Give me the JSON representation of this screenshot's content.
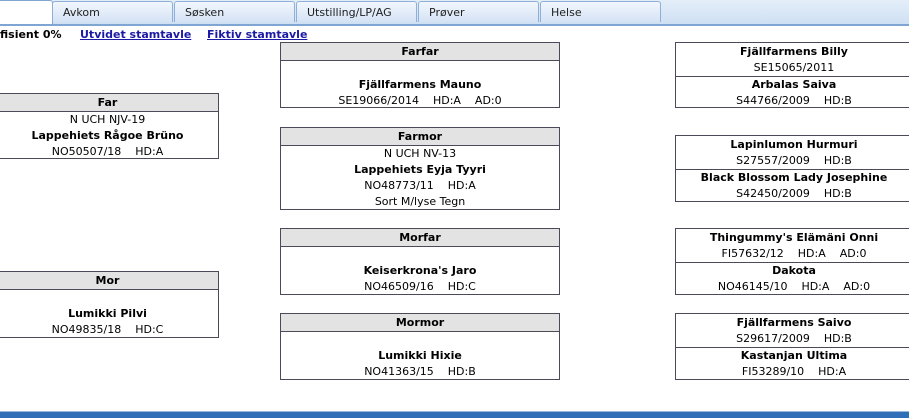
{
  "tabs": [
    "",
    "Avkom",
    "Søsken",
    "Utstilling/LP/AG",
    "Prøver",
    "Helse"
  ],
  "top": {
    "coefficient": "fisient 0%",
    "extended_link": "Utvidet stamtavle",
    "fictive_link": "Fiktiv stamtavle"
  },
  "parents": {
    "far": {
      "header": "Far",
      "title": "N UCH NJV-19",
      "name": "Lappehiets Rågoe Brüno",
      "reg": "NO50507/18    HD:A"
    },
    "mor": {
      "header": "Mor",
      "title": "",
      "name": "Lumikki Pilvi",
      "reg": "NO49835/18    HD:C"
    }
  },
  "grandparents": {
    "farfar": {
      "header": "Farfar",
      "title": "",
      "name": "Fjällfarmens Mauno",
      "reg": "SE19066/2014    HD:A    AD:0",
      "extra": ""
    },
    "farmor": {
      "header": "Farmor",
      "title": "N UCH NV-13",
      "name": "Lappehiets Eyja Tyyri",
      "reg": "NO48773/11    HD:A",
      "extra": "Sort M/lyse Tegn"
    },
    "morfar": {
      "header": "Morfar",
      "title": "",
      "name": "Keiserkrona's Jaro",
      "reg": "NO46509/16    HD:C",
      "extra": ""
    },
    "mormor": {
      "header": "Mormor",
      "title": "",
      "name": "Lumikki Hixie",
      "reg": "NO41363/15    HD:B",
      "extra": ""
    }
  },
  "great_grandparents": [
    {
      "name": "Fjällfarmens Billy",
      "reg": "SE15065/2011"
    },
    {
      "name": "Arbalas Saiva",
      "reg": "S44766/2009    HD:B"
    },
    {
      "name": "Lapinlumon Hurmuri",
      "reg": "S27557/2009    HD:B"
    },
    {
      "name": "Black Blossom Lady Josephine",
      "reg": "S42450/2009    HD:B"
    },
    {
      "name": "Thingummy's Elämäni Onni",
      "reg": "FI57632/12    HD:A    AD:0"
    },
    {
      "name": "Dakota",
      "reg": "NO46145/10    HD:A    AD:0"
    },
    {
      "name": "Fjällfarmens Saivo",
      "reg": "S29617/2009    HD:B"
    },
    {
      "name": "Kastanjan Ultima",
      "reg": "FI53289/10    HD:A"
    }
  ]
}
